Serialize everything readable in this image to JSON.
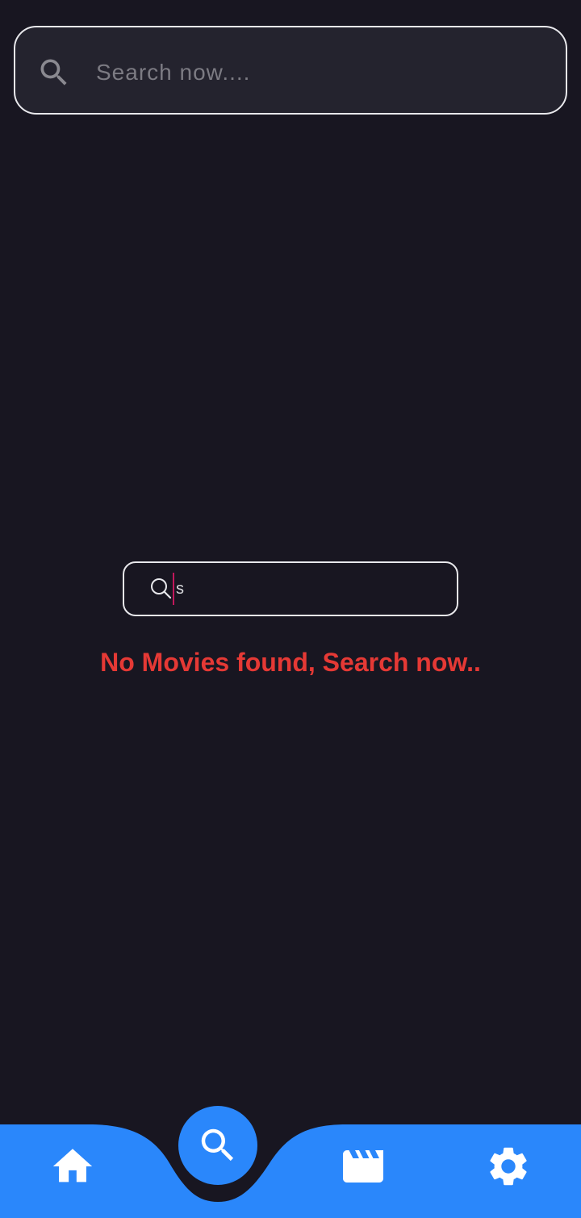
{
  "search": {
    "placeholder": "Search now....",
    "value": "",
    "icon": "search-icon"
  },
  "empty_state": {
    "illustration": {
      "icon": "search-icon",
      "typed_text": "s"
    },
    "message": "No Movies found, Search now.."
  },
  "bottom_nav": {
    "items": [
      {
        "name": "home",
        "icon": "home-icon"
      },
      {
        "name": "search",
        "icon": "search-icon",
        "active": true
      },
      {
        "name": "movies",
        "icon": "clapperboard-icon"
      },
      {
        "name": "settings",
        "icon": "gear-icon"
      }
    ]
  },
  "colors": {
    "background": "#181621",
    "search_field": "#24232e",
    "accent": "#2a87fb",
    "error_text": "#e53935",
    "placeholder": "#7c7b83"
  }
}
